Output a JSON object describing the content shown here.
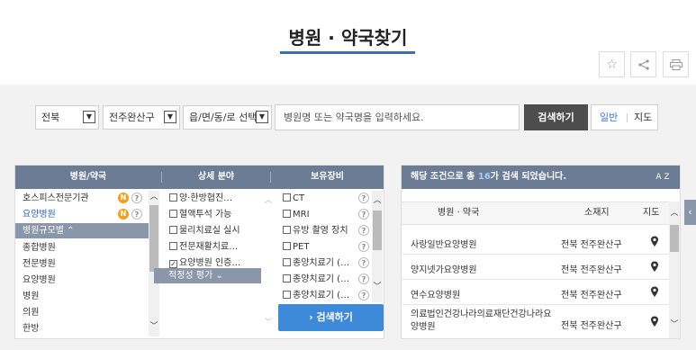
{
  "page": {
    "title": "병원 · 약국찾기"
  },
  "toolbar": {
    "star_icon": "☆",
    "share_icon": "<",
    "print_icon": "⎙"
  },
  "search": {
    "province": "전북",
    "city": "전주완산구",
    "district": "읍/면/동/로 선택",
    "placeholder": "병원명 또는 약국명을 입력하세요.",
    "button": "검색하기",
    "mode_general": "일반",
    "mode_map": "지도"
  },
  "filters": {
    "col1_header": "병원/약국",
    "col2_header": "상세 분야",
    "col3_header": "보유장비",
    "types": [
      "호스피스전문기관",
      "요양병원",
      "병원규모별 ⌃",
      "종합병원",
      "전문병원",
      "요양병원",
      "병원",
      "의원",
      "한방"
    ],
    "specialties": [
      {
        "label": "양·한방협진…",
        "checked": false
      },
      {
        "label": "혈액투석 가능",
        "checked": false
      },
      {
        "label": "물리치료실 실시",
        "checked": false
      },
      {
        "label": "전문재활치료…",
        "checked": false
      },
      {
        "label": "요양병원 인증…",
        "checked": true
      }
    ],
    "evaluation": "적정성 평가 ⌄",
    "equipment": [
      "CT",
      "MRI",
      "유방 촬영 장치",
      "PET",
      "종양치료기 (…",
      "종양치료기 (…",
      "종양치료기 (…"
    ],
    "badge_n": "N",
    "badge_q": "?",
    "go_button": "› 검색하기"
  },
  "results": {
    "summary_prefix": "해당 조건으로 총 ",
    "count": "16",
    "summary_suffix": "가 검색 되었습니다.",
    "sort_label": "A Z",
    "col_name": "병원 · 약국",
    "col_loc": "소재지",
    "col_map": "지도",
    "rows": [
      {
        "name": "사랑일반요양병원",
        "loc": "전북 전주완산구"
      },
      {
        "name": "양지넷가요양병원",
        "loc": "전북 전주완산구"
      },
      {
        "name": "연수요양병원",
        "loc": "전북 전주완산구"
      },
      {
        "name": "의료법인건강나라의료재단건강나라요양병원",
        "loc": "전북 전주완산구"
      }
    ]
  },
  "side_tab": "‹"
}
